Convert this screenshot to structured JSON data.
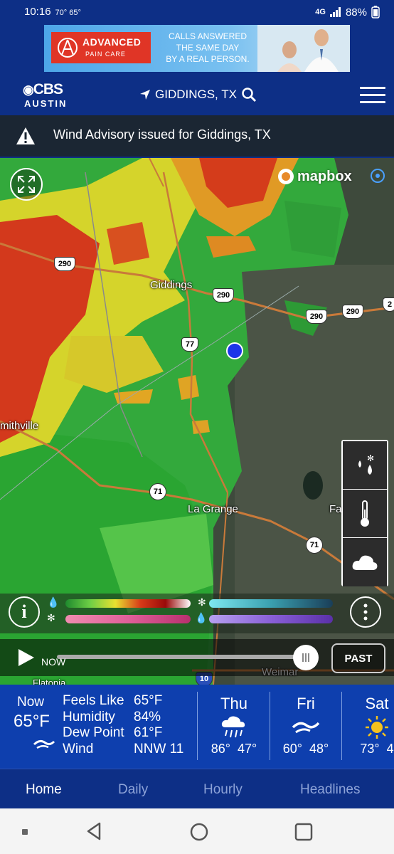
{
  "status": {
    "time": "10:16",
    "temps": "70° 65°",
    "network": "4G",
    "battery": "88%"
  },
  "ad": {
    "brand": "ADVANCED",
    "brand_sub": "PAIN CARE",
    "lines": [
      "CALLS ANSWERED",
      "THE SAME DAY",
      "BY A REAL PERSON."
    ]
  },
  "header": {
    "logo_top": "CBS",
    "logo_bottom": "AUSTIN",
    "location": "GIDDINGS, TX"
  },
  "alert": {
    "text": "Wind Advisory issued for Giddings, TX"
  },
  "map": {
    "attribution": "mapbox",
    "places": [
      "Giddings",
      "mithville",
      "La Grange",
      "Fayetteville",
      "Weimar",
      "Flatonia"
    ],
    "routes": [
      "290",
      "290",
      "290",
      "290",
      "77",
      "71",
      "71",
      "10",
      "2"
    ],
    "playback": {
      "now_label": "NOW",
      "mode_button": "PAST"
    }
  },
  "weather": {
    "now_label": "Now",
    "now_temp": "65°F",
    "details": [
      {
        "label": "Feels Like",
        "value": "65°F"
      },
      {
        "label": "Humidity",
        "value": "84%"
      },
      {
        "label": "Dew Point",
        "value": "61°F"
      },
      {
        "label": "Wind",
        "value": "NNW 11"
      }
    ],
    "forecast": [
      {
        "day": "Thu",
        "high": "86°",
        "low": "47°",
        "icon": "rain-cloud-icon"
      },
      {
        "day": "Fri",
        "high": "60°",
        "low": "48°",
        "icon": "wind-icon"
      },
      {
        "day": "Sat",
        "high": "73°",
        "low": "4",
        "icon": "sun-icon"
      }
    ]
  },
  "tabs": [
    "Home",
    "Daily",
    "Hourly",
    "Headlines"
  ]
}
